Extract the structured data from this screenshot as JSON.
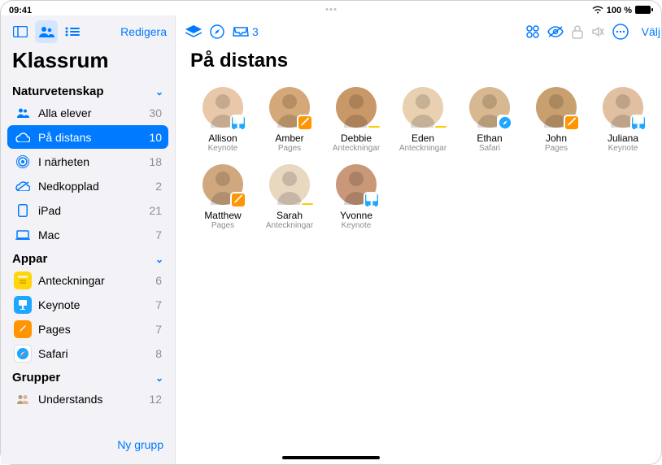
{
  "status": {
    "time": "09:41",
    "battery": "100 %"
  },
  "sidebar": {
    "edit": "Redigera",
    "title": "Klassrum",
    "sections": [
      {
        "header": "Naturvetenskap",
        "items": [
          {
            "icon": "people",
            "label": "Alla elever",
            "count": 30
          },
          {
            "icon": "cloud",
            "label": "På distans",
            "count": 10,
            "selected": true
          },
          {
            "icon": "near",
            "label": "I närheten",
            "count": 18
          },
          {
            "icon": "offline",
            "label": "Nedkopplad",
            "count": 2
          },
          {
            "icon": "ipad",
            "label": "iPad",
            "count": 21
          },
          {
            "icon": "mac",
            "label": "Mac",
            "count": 7
          }
        ]
      },
      {
        "header": "Appar",
        "items": [
          {
            "icon": "app-notes",
            "label": "Anteckningar",
            "count": 6
          },
          {
            "icon": "app-keynote",
            "label": "Keynote",
            "count": 7
          },
          {
            "icon": "app-pages",
            "label": "Pages",
            "count": 7
          },
          {
            "icon": "app-safari",
            "label": "Safari",
            "count": 8
          }
        ]
      },
      {
        "header": "Grupper",
        "items": [
          {
            "icon": "group",
            "label": "Understands",
            "count": 12
          }
        ]
      }
    ],
    "new_group": "Ny grupp"
  },
  "main": {
    "inbox_count": 3,
    "select": "Välj",
    "title": "På distans",
    "students": [
      {
        "name": "Allison",
        "app": "Keynote",
        "badge": "keynote"
      },
      {
        "name": "Amber",
        "app": "Pages",
        "badge": "pages"
      },
      {
        "name": "Debbie",
        "app": "Anteckningar",
        "badge": "dash"
      },
      {
        "name": "Eden",
        "app": "Anteckningar",
        "badge": "dash"
      },
      {
        "name": "Ethan",
        "app": "Safari",
        "badge": "safari"
      },
      {
        "name": "John",
        "app": "Pages",
        "badge": "pages"
      },
      {
        "name": "Juliana",
        "app": "Keynote",
        "badge": "keynote"
      },
      {
        "name": "Matthew",
        "app": "Pages",
        "badge": "pages"
      },
      {
        "name": "Sarah",
        "app": "Anteckningar",
        "badge": "dash"
      },
      {
        "name": "Yvonne",
        "app": "Keynote",
        "badge": "keynote"
      }
    ]
  }
}
